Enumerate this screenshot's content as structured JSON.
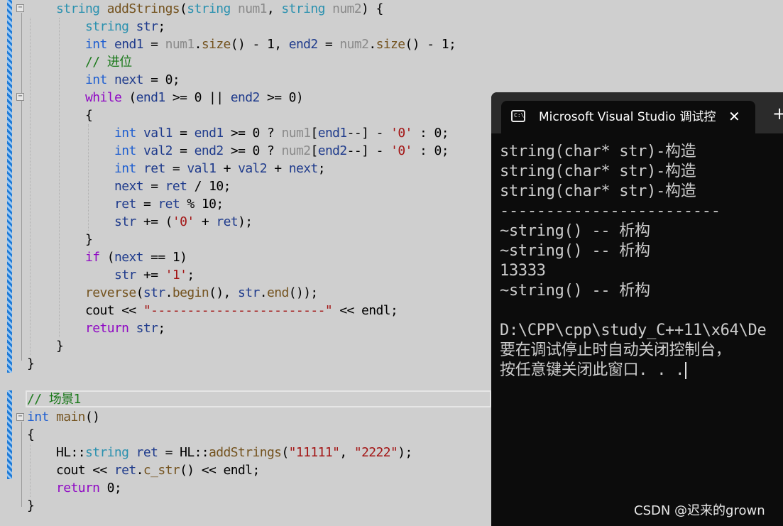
{
  "editor": {
    "lines": [
      [
        {
          "t": "string",
          "c": "ty"
        },
        {
          "t": " "
        },
        {
          "t": "addStrings",
          "c": "fn"
        },
        {
          "t": "("
        },
        {
          "t": "string",
          "c": "ty"
        },
        {
          "t": " "
        },
        {
          "t": "num1",
          "c": "prm"
        },
        {
          "t": ", "
        },
        {
          "t": "string",
          "c": "ty"
        },
        {
          "t": " "
        },
        {
          "t": "num2",
          "c": "prm"
        },
        {
          "t": ") {"
        }
      ],
      [
        {
          "t": "string",
          "c": "ty"
        },
        {
          "t": " "
        },
        {
          "t": "str",
          "c": "var"
        },
        {
          "t": ";"
        }
      ],
      [
        {
          "t": "int",
          "c": "kw"
        },
        {
          "t": " "
        },
        {
          "t": "end1",
          "c": "var"
        },
        {
          "t": " = "
        },
        {
          "t": "num1",
          "c": "prm"
        },
        {
          "t": "."
        },
        {
          "t": "size",
          "c": "fn"
        },
        {
          "t": "() - 1, "
        },
        {
          "t": "end2",
          "c": "var"
        },
        {
          "t": " = "
        },
        {
          "t": "num2",
          "c": "prm"
        },
        {
          "t": "."
        },
        {
          "t": "size",
          "c": "fn"
        },
        {
          "t": "() - 1;"
        }
      ],
      [
        {
          "t": "// 进位",
          "c": "cmt"
        }
      ],
      [
        {
          "t": "int",
          "c": "kw"
        },
        {
          "t": " "
        },
        {
          "t": "next",
          "c": "var"
        },
        {
          "t": " = 0;"
        }
      ],
      [
        {
          "t": "while",
          "c": "ctl"
        },
        {
          "t": " ("
        },
        {
          "t": "end1",
          "c": "var"
        },
        {
          "t": " >= 0 || "
        },
        {
          "t": "end2",
          "c": "var"
        },
        {
          "t": " >= 0)"
        }
      ],
      [
        {
          "t": "{"
        }
      ],
      [
        {
          "t": "int",
          "c": "kw"
        },
        {
          "t": " "
        },
        {
          "t": "val1",
          "c": "var"
        },
        {
          "t": " = "
        },
        {
          "t": "end1",
          "c": "var"
        },
        {
          "t": " >= 0 ? "
        },
        {
          "t": "num1",
          "c": "prm"
        },
        {
          "t": "["
        },
        {
          "t": "end1",
          "c": "var"
        },
        {
          "t": "--] - "
        },
        {
          "t": "'0'",
          "c": "str"
        },
        {
          "t": " : 0;"
        }
      ],
      [
        {
          "t": "int",
          "c": "kw"
        },
        {
          "t": " "
        },
        {
          "t": "val2",
          "c": "var"
        },
        {
          "t": " = "
        },
        {
          "t": "end2",
          "c": "var"
        },
        {
          "t": " >= 0 ? "
        },
        {
          "t": "num2",
          "c": "prm"
        },
        {
          "t": "["
        },
        {
          "t": "end2",
          "c": "var"
        },
        {
          "t": "--] - "
        },
        {
          "t": "'0'",
          "c": "str"
        },
        {
          "t": " : 0;"
        }
      ],
      [
        {
          "t": "int",
          "c": "kw"
        },
        {
          "t": " "
        },
        {
          "t": "ret",
          "c": "var"
        },
        {
          "t": " = "
        },
        {
          "t": "val1",
          "c": "var"
        },
        {
          "t": " + "
        },
        {
          "t": "val2",
          "c": "var"
        },
        {
          "t": " + "
        },
        {
          "t": "next",
          "c": "var"
        },
        {
          "t": ";"
        }
      ],
      [
        {
          "t": "next",
          "c": "var"
        },
        {
          "t": " = "
        },
        {
          "t": "ret",
          "c": "var"
        },
        {
          "t": " / 10;"
        }
      ],
      [
        {
          "t": "ret",
          "c": "var"
        },
        {
          "t": " = "
        },
        {
          "t": "ret",
          "c": "var"
        },
        {
          "t": " % 10;"
        }
      ],
      [
        {
          "t": "str",
          "c": "var"
        },
        {
          "t": " += ("
        },
        {
          "t": "'0'",
          "c": "str"
        },
        {
          "t": " + "
        },
        {
          "t": "ret",
          "c": "var"
        },
        {
          "t": ");"
        }
      ],
      [
        {
          "t": "}"
        }
      ],
      [
        {
          "t": "if",
          "c": "ctl"
        },
        {
          "t": " ("
        },
        {
          "t": "next",
          "c": "var"
        },
        {
          "t": " == 1)"
        }
      ],
      [
        {
          "t": "str",
          "c": "var"
        },
        {
          "t": " += "
        },
        {
          "t": "'1'",
          "c": "str"
        },
        {
          "t": ";"
        }
      ],
      [
        {
          "t": "reverse",
          "c": "fn"
        },
        {
          "t": "("
        },
        {
          "t": "str",
          "c": "var"
        },
        {
          "t": "."
        },
        {
          "t": "begin",
          "c": "fn"
        },
        {
          "t": "(), "
        },
        {
          "t": "str",
          "c": "var"
        },
        {
          "t": "."
        },
        {
          "t": "end",
          "c": "fn"
        },
        {
          "t": "());"
        }
      ],
      [
        {
          "t": "cout"
        },
        {
          "t": " << "
        },
        {
          "t": "\"------------------------\"",
          "c": "str"
        },
        {
          "t": " << "
        },
        {
          "t": "endl"
        },
        {
          "t": ";"
        }
      ],
      [
        {
          "t": "return",
          "c": "ctl"
        },
        {
          "t": " "
        },
        {
          "t": "str",
          "c": "var"
        },
        {
          "t": ";"
        }
      ],
      [
        {
          "t": "}"
        }
      ],
      [
        {
          "t": "}"
        }
      ],
      [
        {
          "t": "// 场景1",
          "c": "cmt"
        }
      ],
      [
        {
          "t": "int",
          "c": "kw"
        },
        {
          "t": " "
        },
        {
          "t": "main",
          "c": "fn"
        },
        {
          "t": "()"
        }
      ],
      [
        {
          "t": "{"
        }
      ],
      [
        {
          "t": "HL"
        },
        {
          "t": "::"
        },
        {
          "t": "string",
          "c": "ty"
        },
        {
          "t": " "
        },
        {
          "t": "ret",
          "c": "var"
        },
        {
          "t": " = "
        },
        {
          "t": "HL"
        },
        {
          "t": "::"
        },
        {
          "t": "addStrings",
          "c": "fn"
        },
        {
          "t": "("
        },
        {
          "t": "\"11111\"",
          "c": "str"
        },
        {
          "t": ", "
        },
        {
          "t": "\"2222\"",
          "c": "str"
        },
        {
          "t": ");"
        }
      ],
      [
        {
          "t": "cout"
        },
        {
          "t": " << "
        },
        {
          "t": "ret",
          "c": "var"
        },
        {
          "t": "."
        },
        {
          "t": "c_str",
          "c": "fn"
        },
        {
          "t": "() << "
        },
        {
          "t": "endl"
        },
        {
          "t": ";"
        }
      ],
      [
        {
          "t": "return",
          "c": "ctl"
        },
        {
          "t": " 0;"
        }
      ],
      [
        {
          "t": "}"
        }
      ]
    ]
  },
  "console": {
    "title": "Microsoft Visual Studio 调试控制台",
    "close_icon": "close-icon",
    "new_tab_label": "+",
    "lines": [
      "string(char* str)-构造",
      "string(char* str)-构造",
      "string(char* str)-构造",
      "------------------------",
      "~string() -- 析构",
      "~string() -- 析构",
      "13333",
      "~string() -- 析构",
      "",
      "D:\\CPP\\cpp\\study_C++11\\x64\\De",
      "要在调试停止时自动关闭控制台，",
      "按任意键关闭此窗口. . ."
    ]
  },
  "watermark": "CSDN @迟来的grown"
}
